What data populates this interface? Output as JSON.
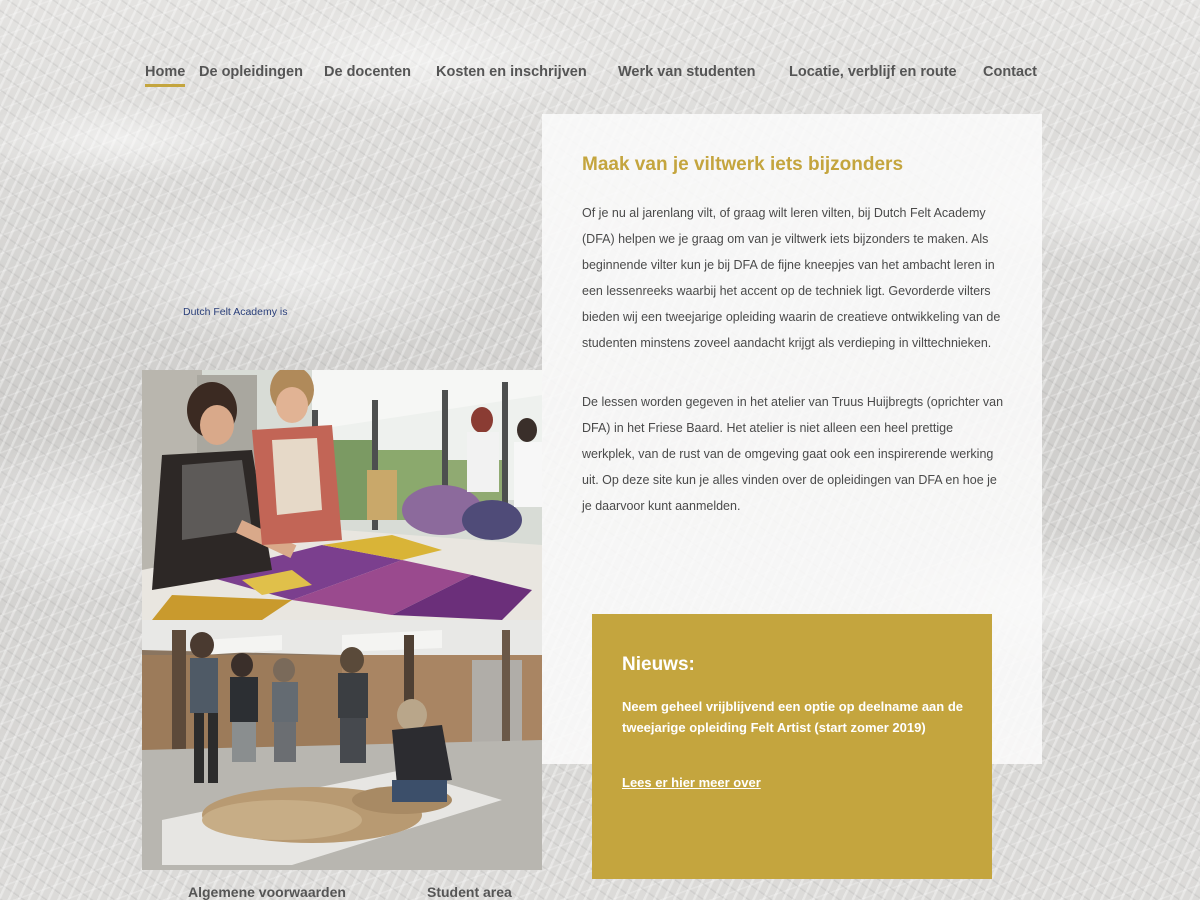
{
  "nav": {
    "items": [
      {
        "label": "Home",
        "active": true
      },
      {
        "label": "De opleidingen",
        "active": false
      },
      {
        "label": "De docenten",
        "active": false
      },
      {
        "label": "Kosten en inschrijven",
        "active": false
      },
      {
        "label": "Werk van studenten",
        "active": false
      },
      {
        "label": "Locatie, verblijf en route",
        "active": false
      },
      {
        "label": "Contact",
        "active": false
      }
    ]
  },
  "intro": {
    "text": "Dutch Felt Academy is"
  },
  "content": {
    "title": "Maak van je viltwerk iets bijzonders",
    "paragraph_1": "Of je nu al jarenlang vilt, of graag wilt leren vilten, bij Dutch Felt Academy (DFA) helpen we je graag om van je viltwerk iets bijzonders te maken. Als beginnende vilter kun je bij DFA de fijne kneepjes van het ambacht leren in een lessenreeks waarbij het accent op de techniek ligt. Gevorderde vilters bieden wij een tweejarige opleiding waarin de creatieve ontwikkeling van de studenten minstens zoveel aandacht krijgt als verdieping in vilttechnieken.",
    "paragraph_2": "De lessen worden gegeven in het atelier van Truus Huijbregts (oprichter van DFA) in het Friese Baard. Het atelier is niet alleen een heel prettige werkplek, van de rust van de omgeving gaat ook een inspirerende werking uit. Op deze site kun je alles vinden over de opleidingen van DFA en hoe je je daarvoor kunt aanmelden."
  },
  "news": {
    "title": "Nieuws:",
    "text": "Neem geheel vrijblijvend een optie op deelname aan de tweejarige opleiding Felt Artist (start zomer 2019)",
    "link": "Lees er hier meer over"
  },
  "footer": {
    "link_1": "Algemene voorwaarden",
    "link_2": "Student area"
  },
  "colors": {
    "accent": "#c4a53e",
    "nav_text": "#555555",
    "body_text": "#4a4a4a"
  }
}
